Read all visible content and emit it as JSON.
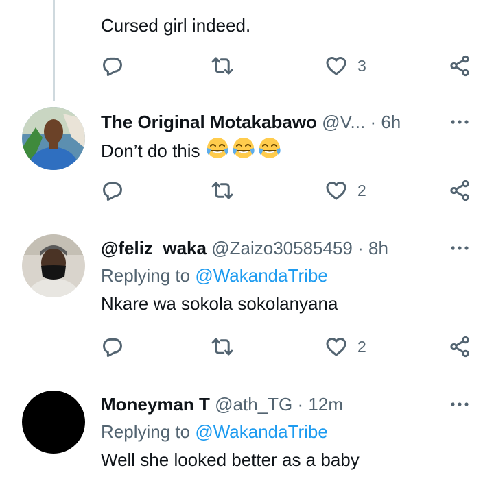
{
  "tweets": [
    {
      "text": "Cursed girl indeed.",
      "likes": "3"
    },
    {
      "name": "The Original Motakabawo",
      "handle": "@V...",
      "separator": "·",
      "time": "6h",
      "text": "Don’t do this",
      "emoji": [
        "face-with-tears-of-joy",
        "face-with-tears-of-joy",
        "face-with-tears-of-joy"
      ],
      "likes": "2"
    },
    {
      "name": "@feliz_waka",
      "handle": "@Zaizo30585459",
      "separator": "·",
      "time": "8h",
      "replying_prefix": "Replying to",
      "replying_to": "@WakandaTribe",
      "text": "Nkare wa sokola sokolanyana",
      "likes": "2"
    },
    {
      "name": "Moneyman T",
      "handle": "@ath_TG",
      "separator": "·",
      "time": "12m",
      "replying_prefix": "Replying to",
      "replying_to": "@WakandaTribe",
      "text": "Well she looked better as a baby"
    }
  ],
  "colors": {
    "text": "#0f1419",
    "secondary": "#536471",
    "link": "#1d9bf0",
    "divider": "#eff3f4"
  }
}
